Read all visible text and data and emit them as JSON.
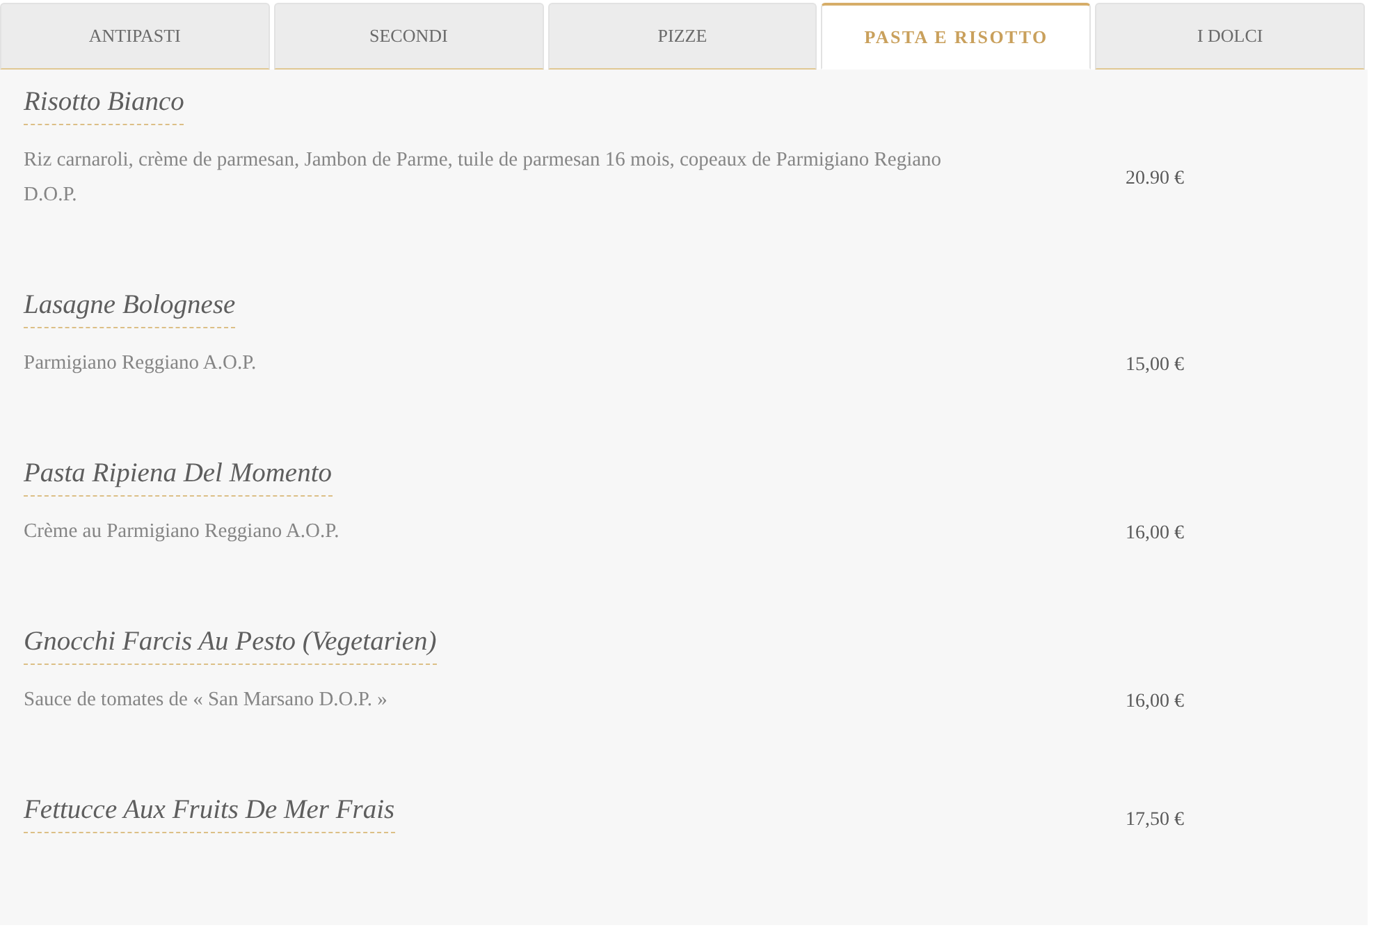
{
  "tabs": [
    {
      "label": "ANTIPASTI",
      "selected": false
    },
    {
      "label": "SECONDI",
      "selected": false
    },
    {
      "label": "PIZZE",
      "selected": false
    },
    {
      "label": "PASTA E RISOTTO",
      "selected": true
    },
    {
      "label": "I DOLCI",
      "selected": false
    }
  ],
  "items": [
    {
      "name": "Risotto Bianco",
      "description": "Riz carnaroli, crème de parmesan, Jambon de Parme, tuile de parmesan 16 mois, copeaux de Parmigiano Regiano D.O.P.",
      "price": "20.90 €"
    },
    {
      "name": "Lasagne Bolognese",
      "description": "Parmigiano Reggiano A.O.P.",
      "price": "15,00 €"
    },
    {
      "name": "Pasta Ripiena Del Momento",
      "description": "Crème au Parmigiano Reggiano A.O.P.",
      "price": "16,00 €"
    },
    {
      "name": "Gnocchi Farcis Au Pesto (Vegetarien)",
      "description": "Sauce de tomates de « San Marsano D.O.P. »",
      "price": "16,00 €"
    },
    {
      "name": "Fettucce Aux Fruits De Mer Frais",
      "price": "17,50 €"
    }
  ]
}
